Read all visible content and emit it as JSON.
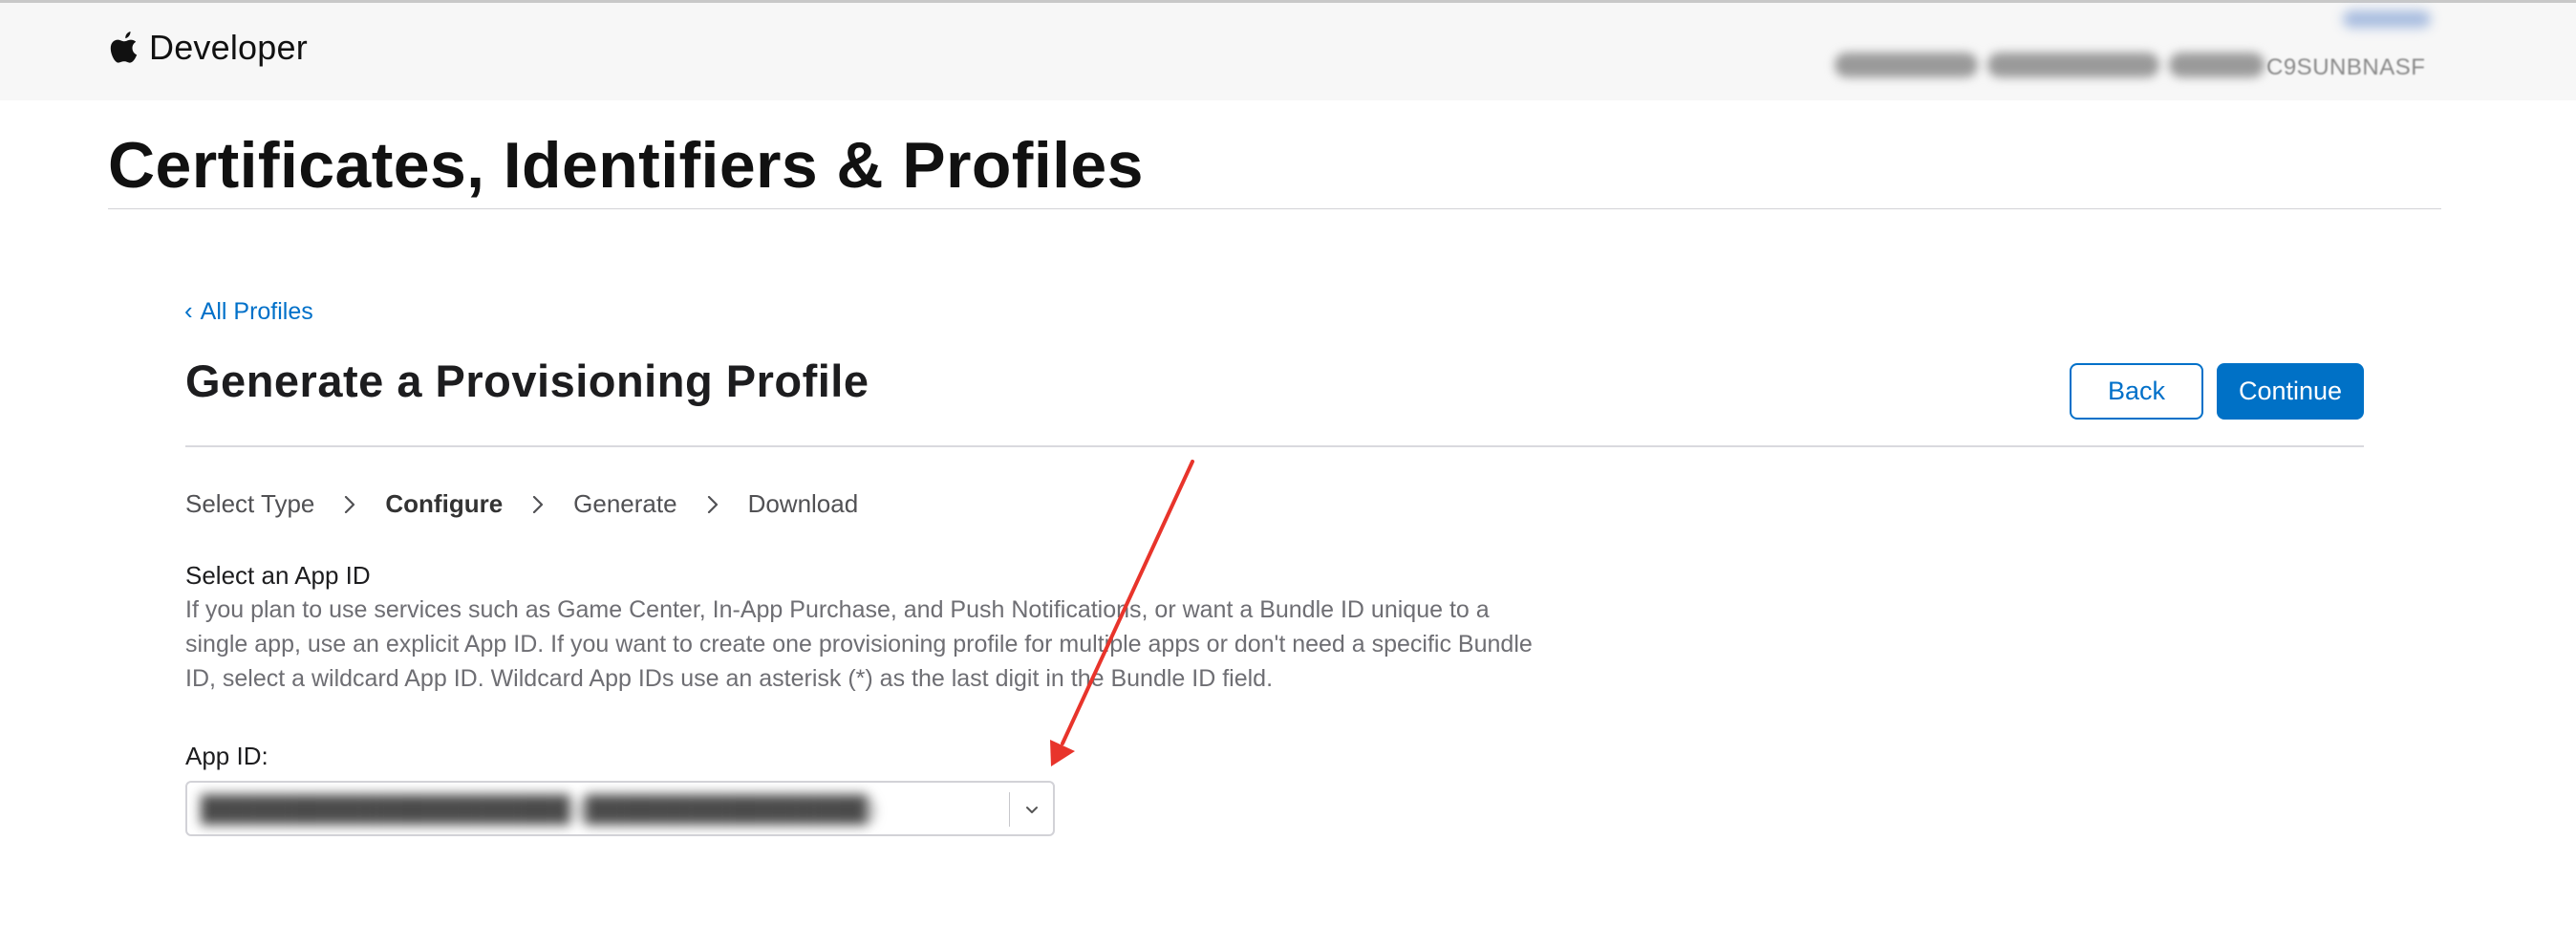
{
  "header": {
    "brand": "Developer",
    "account_name": "████████████ ████████",
    "account_id": "C9SUNBNASF",
    "account_menu": "███████"
  },
  "page_title": "Certificates, Identifiers & Profiles",
  "back_link": "All Profiles",
  "section_title": "Generate a Provisioning Profile",
  "buttons": {
    "back": "Back",
    "continue": "Continue"
  },
  "steps": [
    {
      "label": "Select Type",
      "current": false
    },
    {
      "label": "Configure",
      "current": true
    },
    {
      "label": "Generate",
      "current": false
    },
    {
      "label": "Download",
      "current": false
    }
  ],
  "form": {
    "heading": "Select an App ID",
    "description": "If you plan to use services such as Game Center, In-App Purchase, and Push Notifications, or want a Bundle ID unique to a single app, use an explicit App ID. If you want to create one provisioning profile for multiple apps or don't need a specific Bundle ID, select a wildcard App ID. Wildcard App IDs use an asterisk (*) as the last digit in the Bundle ID field.",
    "app_id_label": "App ID:",
    "app_id_value": "█████████████████████ (████████████████)"
  },
  "icons": {
    "brand": "apple-logo-icon",
    "back": "chevron-left-icon",
    "step_separator": "chevron-right-icon",
    "select": "chevron-down-icon"
  },
  "colors": {
    "accent": "#0070c9",
    "primary_button": "#0071c6",
    "header_bg": "#f7f7f7",
    "annotation": "#e8342b"
  }
}
